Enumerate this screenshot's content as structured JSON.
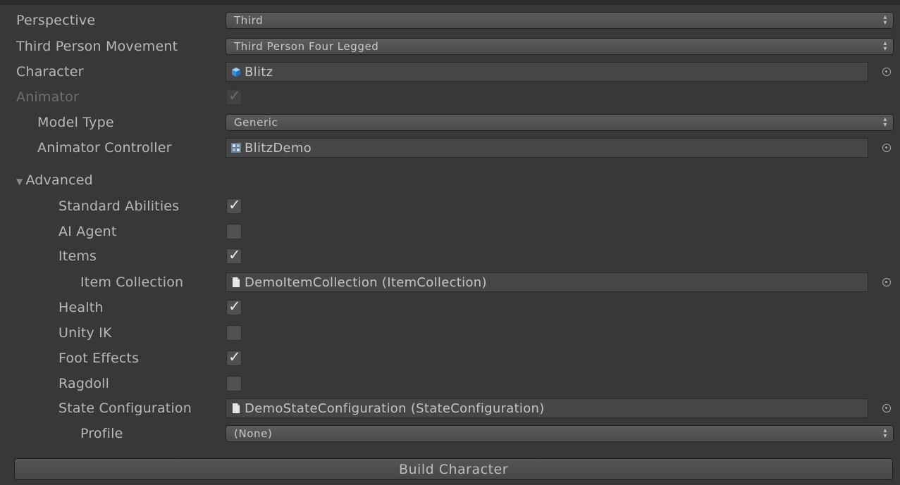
{
  "fields": {
    "perspective": {
      "label": "Perspective",
      "value": "Third"
    },
    "movement": {
      "label": "Third Person Movement",
      "value": "Third Person Four Legged"
    },
    "character": {
      "label": "Character",
      "value": "Blitz"
    },
    "animator": {
      "label": "Animator",
      "checked": true,
      "disabled": true
    },
    "model_type": {
      "label": "Model Type",
      "value": "Generic"
    },
    "animator_controller": {
      "label": "Animator Controller",
      "value": "BlitzDemo"
    },
    "advanced": {
      "label": "Advanced",
      "expanded": true
    },
    "standard_abilities": {
      "label": "Standard Abilities",
      "checked": true
    },
    "ai_agent": {
      "label": "AI Agent",
      "checked": false
    },
    "items": {
      "label": "Items",
      "checked": true
    },
    "item_collection": {
      "label": "Item Collection",
      "value": "DemoItemCollection (ItemCollection)"
    },
    "health": {
      "label": "Health",
      "checked": true
    },
    "unity_ik": {
      "label": "Unity IK",
      "checked": false
    },
    "foot_effects": {
      "label": "Foot Effects",
      "checked": true
    },
    "ragdoll": {
      "label": "Ragdoll",
      "checked": false
    },
    "state_configuration": {
      "label": "State Configuration",
      "value": "DemoStateConfiguration (StateConfiguration)"
    },
    "profile": {
      "label": "Profile",
      "value": "(None)"
    }
  },
  "build_button": {
    "label": "Build Character"
  },
  "icons": {
    "dropdown": "dropdown-arrows-icon",
    "object_picker": "object-picker-icon",
    "prefab": "prefab-cube-icon",
    "animator_controller": "animator-controller-icon",
    "script_asset": "scriptable-object-icon",
    "checkmark": "checkmark-icon",
    "foldout": "foldout-triangle-icon"
  },
  "colors": {
    "background": "#383838",
    "field": "#464646",
    "text": "#b8b8b8",
    "disabled_text": "#6f6f6f"
  }
}
